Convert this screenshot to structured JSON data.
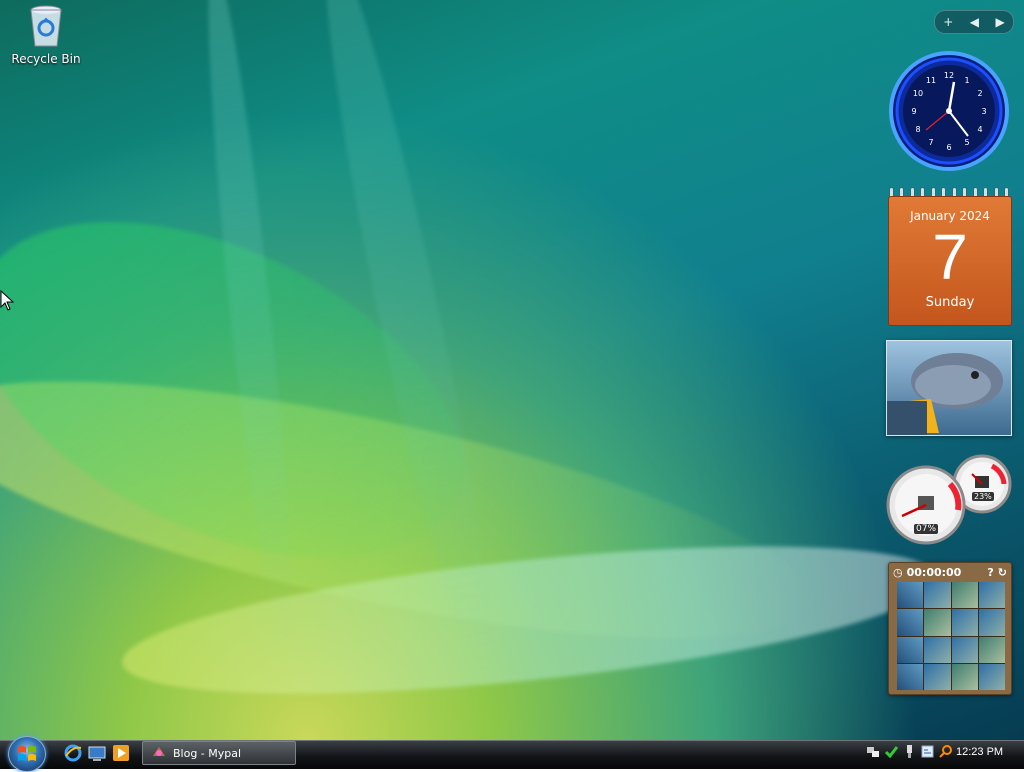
{
  "desktop": {
    "icons": [
      {
        "label": "Recycle Bin",
        "icon": "recycle-bin-icon"
      }
    ]
  },
  "sidebar": {
    "controls": {
      "add": "+",
      "prev": "◀",
      "next": "▶"
    },
    "calendar": {
      "month_year": "January 2024",
      "day": "7",
      "weekday": "Sunday"
    },
    "cpu_meter": {
      "cpu": "07%",
      "memory": "23%"
    },
    "puzzle": {
      "timer": "00:00:00"
    }
  },
  "taskbar": {
    "quick_launch": [
      "internet-explorer-icon",
      "show-desktop-icon",
      "media-player-icon"
    ],
    "task_button": {
      "label": "Blog - Mypal"
    },
    "tray_icons": [
      "network-icon",
      "defender-icon",
      "safely-remove-icon",
      "volume-icon",
      "search-icon"
    ],
    "clock": "12:23 PM"
  },
  "colors": {
    "calendar_orange": "#d2682a",
    "clock_blue": "#1e4fff"
  }
}
